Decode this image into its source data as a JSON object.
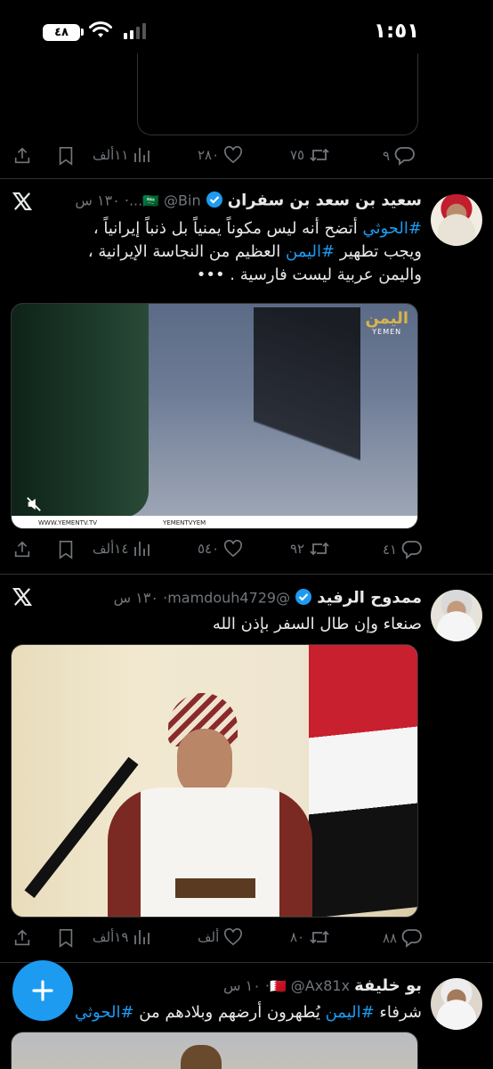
{
  "status_bar": {
    "time": "١:٥١",
    "battery": "٤٨"
  },
  "colors": {
    "accent": "#1d9bf0",
    "muted": "#71767b",
    "text": "#e7e9ea",
    "divider": "#2f3336"
  },
  "top_tweet_actions": {
    "replies": "٩",
    "retweets": "٧٥",
    "likes": "٢٨٠",
    "views": "١١ألف"
  },
  "tweets": [
    {
      "name": "سعيد بن سعد بن سفران",
      "flag": "🇸🇦",
      "handle": "@Bin...",
      "time": "١٣٠ س",
      "text_line1_tag": "#الحوثي",
      "text_line1_rest": " أتضح أنه ليس مكوناً يمنياً بل ذنباً إيرانياً ،",
      "text_line2_pre": "ويجب تطهير ",
      "text_line2_tag": "#اليمن",
      "text_line2_rest": " العظيم من النجاسة الإيرانية ،",
      "text_line3": "واليمن عربية ليست فارسية . •••",
      "media_logo": "اليمن",
      "media_logo_sub": "YEMEN",
      "media_footer_left": "WWW.YEMENTV.TV",
      "media_footer_right": "YEMENTVYEM",
      "actions": {
        "replies": "٤١",
        "retweets": "٩٢",
        "likes": "٥٤٠",
        "views": "١٤ألف"
      }
    },
    {
      "name": "ممدوح الرفيد",
      "handle": "@mamdouh4729",
      "time": "١٣٠ س",
      "text": "صنعاء وإن طال السفر بإذن الله",
      "actions": {
        "replies": "٨٨",
        "retweets": "٨٠",
        "likes": "ألف",
        "views": "١٩ألف"
      }
    },
    {
      "name": "بو خليفة",
      "flag": "🇧🇭",
      "handle": "@Ax81x",
      "time": "١٠ س",
      "text_pre": "شرفاء ",
      "text_tag1": "#اليمن",
      "text_mid": " يُطهرون أرضهم وبلادهم من ",
      "text_tag2": "#الحوثي"
    }
  ]
}
